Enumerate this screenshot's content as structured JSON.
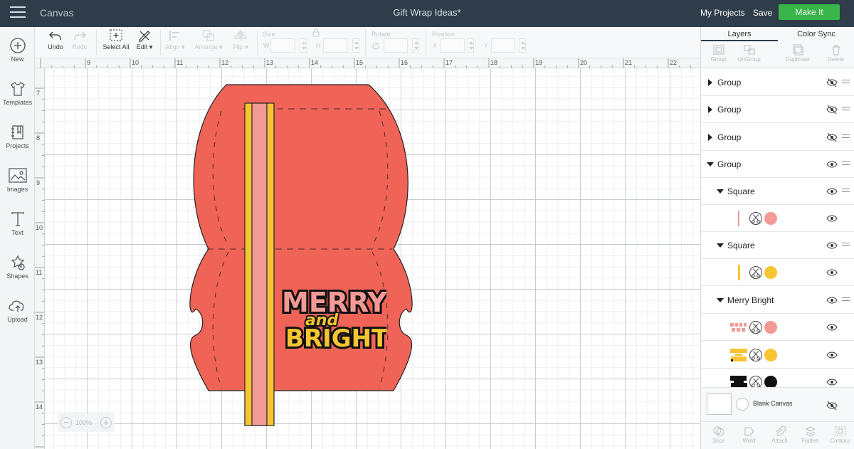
{
  "topbar": {
    "app_title": "Canvas",
    "document_title": "Gift Wrap Ideas*",
    "my_projects": "My Projects",
    "save": "Save",
    "make_it": "Make It",
    "make_it_color": "#39b54a"
  },
  "leftrail": {
    "items": [
      {
        "label": "New",
        "icon": "plus-circle-icon"
      },
      {
        "label": "Templates",
        "icon": "tshirt-icon"
      },
      {
        "label": "Projects",
        "icon": "notebook-icon"
      },
      {
        "label": "Images",
        "icon": "image-icon"
      },
      {
        "label": "Text",
        "icon": "text-icon"
      },
      {
        "label": "Shapes",
        "icon": "shapes-icon"
      },
      {
        "label": "Upload",
        "icon": "cloud-upload-icon"
      }
    ]
  },
  "toolbar": {
    "undo": "Undo",
    "redo": "Redo",
    "select_all": "Select All",
    "edit": "Edit",
    "align": "Align",
    "arrange": "Arrange",
    "flip": "Flip",
    "size": "Size",
    "w": "W",
    "h": "H",
    "rotate": "Rotate",
    "position": "Position",
    "x": "X",
    "y": "Y"
  },
  "ruler": {
    "top": [
      "9",
      "10",
      "11",
      "12",
      "13",
      "14",
      "15",
      "16",
      "17",
      "18",
      "19",
      "20",
      "21",
      "22"
    ],
    "left": [
      "7",
      "8",
      "9",
      "10",
      "11",
      "12",
      "13",
      "14"
    ]
  },
  "canvas": {
    "zoom": "100%",
    "design_text_line1": "MERRY",
    "design_text_line2": "and",
    "design_text_line3": "BRIGHT",
    "box_color": "#f06458",
    "stripe_yellow": "#f7c531",
    "stripe_pink": "#f39a97"
  },
  "panel": {
    "tabs": [
      "Layers",
      "Color Sync"
    ],
    "actions": [
      "Group",
      "UnGroup",
      "Duplicate",
      "Delete"
    ],
    "layers": [
      {
        "name": "Group",
        "expanded": false,
        "visible": false
      },
      {
        "name": "Group",
        "expanded": false,
        "visible": false
      },
      {
        "name": "Group",
        "expanded": false,
        "visible": false
      },
      {
        "name": "Group",
        "expanded": true,
        "visible": true
      },
      {
        "name": "Square",
        "expanded": true,
        "visible": true
      },
      {
        "name": "",
        "color": "#f39a97"
      },
      {
        "name": "Square",
        "expanded": true,
        "visible": true
      },
      {
        "name": "",
        "color": "#f7c531"
      },
      {
        "name": "Merry Bright",
        "expanded": true,
        "visible": true
      },
      {
        "name": "",
        "color": "#f39a97"
      },
      {
        "name": "",
        "color": "#f7c531"
      },
      {
        "name": "",
        "color": "#111111"
      }
    ],
    "blank_canvas": "Blank Canvas",
    "bottom_actions": [
      "Slice",
      "Weld",
      "Attach",
      "Flatten",
      "Contour"
    ]
  }
}
